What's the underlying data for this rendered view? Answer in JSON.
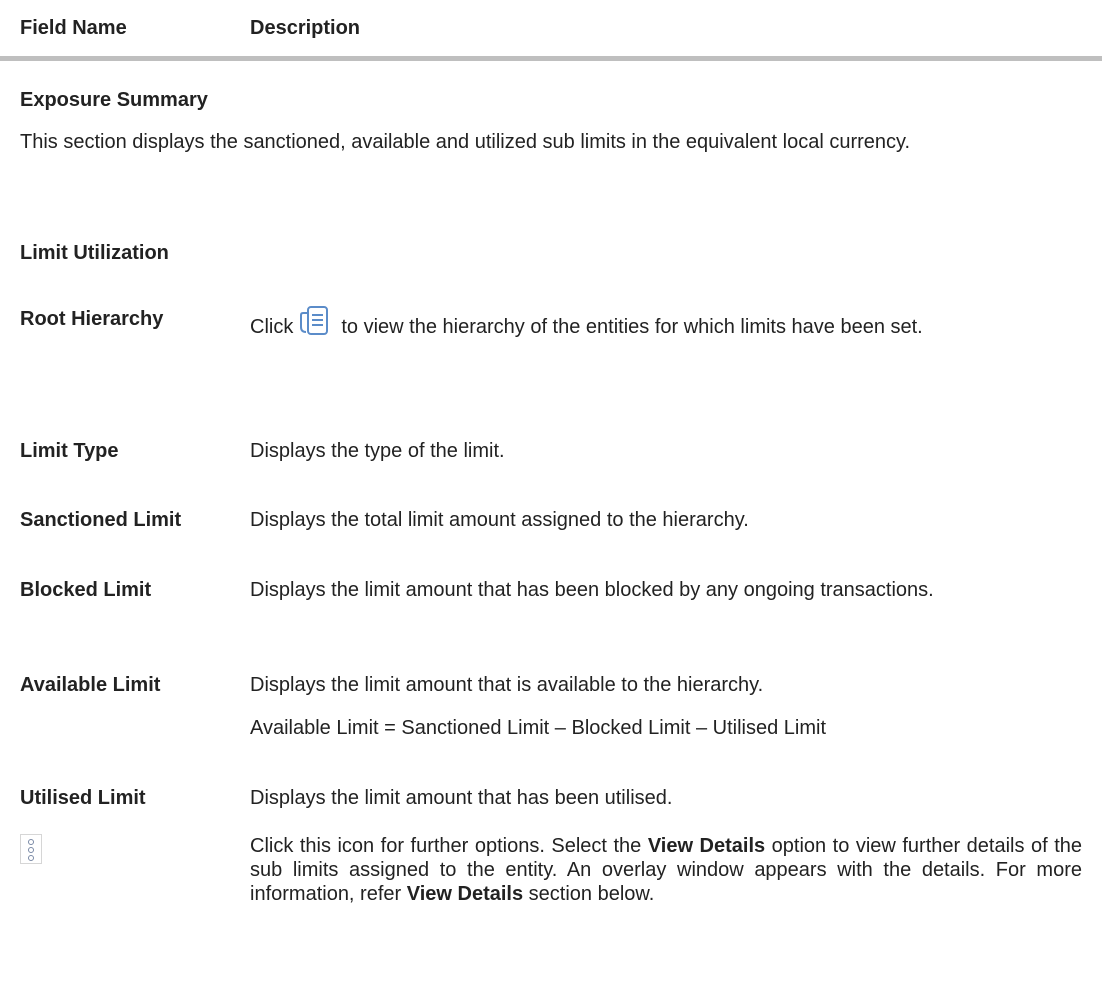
{
  "header": {
    "col1": "Field Name",
    "col2": "Description"
  },
  "exposure": {
    "title": "Exposure Summary",
    "description": "This section displays the sanctioned, available and utilized sub limits in the equivalent local currency."
  },
  "limit_utilization": {
    "title": "Limit Utilization"
  },
  "fields": {
    "root_hierarchy": {
      "name": "Root Hierarchy",
      "desc_before": "Click",
      "icon": "document-list-icon",
      "desc_after": "to view the hierarchy of the entities for which limits have been set."
    },
    "limit_type": {
      "name": "Limit Type",
      "desc": "Displays the type of the limit."
    },
    "sanctioned_limit": {
      "name": "Sanctioned Limit",
      "desc": "Displays the total limit amount assigned to the hierarchy."
    },
    "blocked_limit": {
      "name": "Blocked Limit",
      "desc": "Displays the limit amount that has been blocked by any ongoing transactions."
    },
    "available_limit": {
      "name": "Available Limit",
      "desc": "Displays the limit amount that is available to the hierarchy.",
      "formula": "Available Limit = Sanctioned Limit – Blocked Limit – Utilised Limit"
    },
    "utilised_limit": {
      "name": "Utilised Limit",
      "desc": "Displays the limit amount that has been utilised."
    },
    "more_options": {
      "icon": "kebab-menu-icon",
      "desc_1": "Click this icon for further options. Select the",
      "bold_1": "View Details",
      "desc_2": "option to view further details of the sub limits assigned to the entity. An overlay window appears with the details. For more information, refer",
      "bold_2": "View Details",
      "desc_3": "section below."
    }
  }
}
